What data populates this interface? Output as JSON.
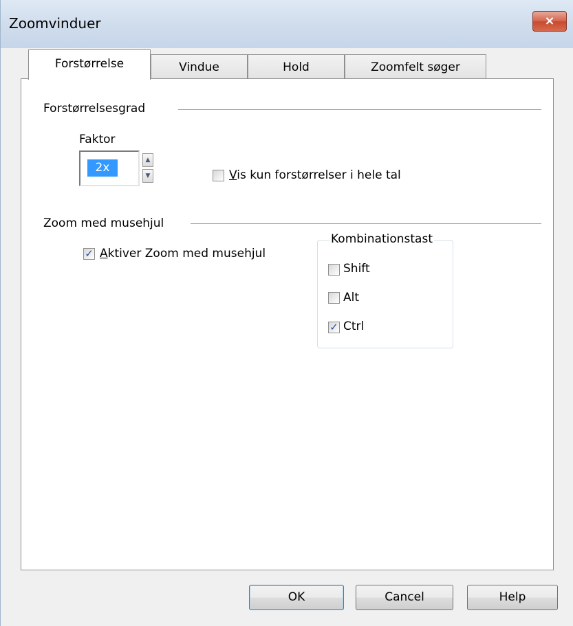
{
  "window": {
    "title": "Zoomvinduer",
    "close_icon": "×"
  },
  "tabs": [
    {
      "label": "Forstørrelse",
      "active": true
    },
    {
      "label": "Vindue",
      "active": false
    },
    {
      "label": "Hold",
      "active": false
    },
    {
      "label": "Zoomfelt søger",
      "active": false
    }
  ],
  "magnification": {
    "section_label": "Forstørrelsesgrad",
    "factor_label": "Faktor",
    "factor_value": "2x",
    "whole_numbers_checkbox": {
      "label_mnemonic": "V",
      "label_rest": "is kun forstørrelser i hele tal",
      "checked": false
    }
  },
  "mousewheel": {
    "section_label": "Zoom med musehjul",
    "enable_checkbox": {
      "label_mnemonic": "A",
      "label_rest": "ktiver Zoom med musehjul",
      "checked": true
    },
    "modifier_group": {
      "title": "Kombinationstast",
      "options": [
        {
          "label": "Shift",
          "checked": false
        },
        {
          "label": "Alt",
          "checked": false
        },
        {
          "label": "Ctrl",
          "checked": true
        }
      ]
    }
  },
  "buttons": {
    "ok": "OK",
    "cancel": "Cancel",
    "help": "Help"
  },
  "colors": {
    "selection": "#3399ff",
    "close_button": "#c74a2f",
    "check_mark": "#2a4c9c"
  }
}
